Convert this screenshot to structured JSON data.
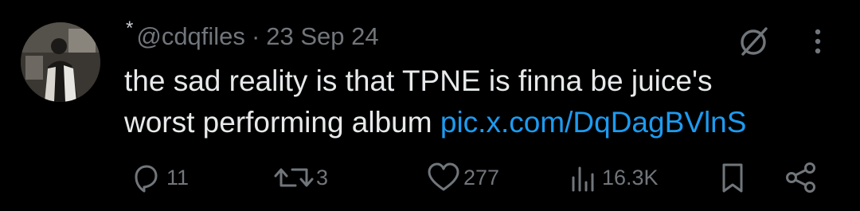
{
  "tweet": {
    "name_mark": "*",
    "handle": "@cdqfiles",
    "separator": "·",
    "date": "23 Sep 24",
    "text_line1": "the sad reality is that TPNE is finna be juice's",
    "text_line2_prefix": "worst performing album ",
    "link_text": "pic.x.com/DqDagBVlnS",
    "link_color": "#1d9bf0"
  },
  "actions": {
    "reply": {
      "icon": "reply-icon",
      "count": "11"
    },
    "repost": {
      "icon": "repost-icon",
      "count": "3"
    },
    "like": {
      "icon": "heart-icon",
      "count": "277"
    },
    "views": {
      "icon": "views-icon",
      "count": "16.3K"
    },
    "bookmark": {
      "icon": "bookmark-icon"
    },
    "share": {
      "icon": "share-icon"
    }
  },
  "header_icons": {
    "grok": "grok-icon",
    "more": "more-icon"
  },
  "colors": {
    "background": "#000000",
    "text": "#e7e9ea",
    "muted": "#71767b",
    "accent": "#1d9bf0"
  }
}
